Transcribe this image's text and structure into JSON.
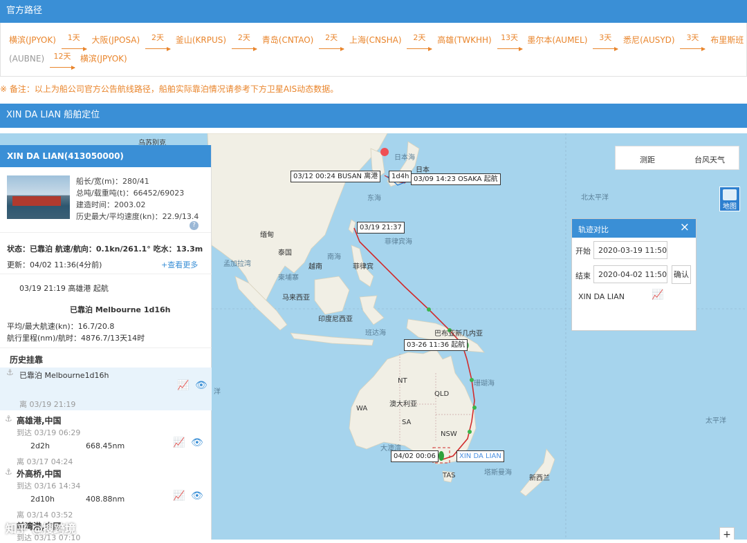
{
  "official_route": {
    "title": "官方路径",
    "stops": [
      {
        "name": "横滨",
        "code": "(JPYOK)"
      },
      {
        "name": "大阪",
        "code": "(JPOSA)"
      },
      {
        "name": "釜山",
        "code": "(KRPUS)"
      },
      {
        "name": "青岛",
        "code": "(CNTAO)"
      },
      {
        "name": "上海",
        "code": "(CNSHA)"
      },
      {
        "name": "高雄",
        "code": "(TWKHH)"
      },
      {
        "name": "墨尔本",
        "code": "(AUMEL)"
      },
      {
        "name": "悉尼",
        "code": "(AUSYD)"
      },
      {
        "name": "布里斯班",
        "code": "(AUBNE)"
      },
      {
        "name": "横滨",
        "code": "(JPYOK)"
      }
    ],
    "legs": [
      "1天",
      "2天",
      "2天",
      "2天",
      "2天",
      "13天",
      "3天",
      "3天",
      "12天"
    ]
  },
  "note": "※ 备注：以上为船公司官方公告航线路径，船舶实际靠泊情况请参考下方卫星AIS动态数据。",
  "section_title": "XIN DA LIAN 船舶定位",
  "ship_panel": {
    "header": "XIN DA LIAN(413050000)",
    "length_width": "船长/宽(m)：280/41",
    "tonnage": "总吨/载重吨(t)：66452/69023",
    "built": "建造时间：2003.02",
    "speed_hist": "历史最大/平均速度(kn)：22.9/13.4",
    "status": "状态：已靠泊 航速/航向：0.1kn/261.1° 吃水：13.3m",
    "updated": "更新：04/02 11:36(4分前)",
    "more": "+查看更多",
    "departure": "03/19 21:19    高雄港 起航",
    "berthed": "已靠泊 Melbourne 1d16h",
    "avg_speed": "平均/最大航速(kn)：16.7/20.8",
    "distance": "航行里程(nm)/航时：4876.7/13天14时",
    "history_title": "历史挂靠",
    "history": [
      {
        "port": "已靠泊 Melbourne1d16h",
        "leave": "离 03/19 21:19"
      },
      {
        "port": "高雄港,中国",
        "arrive": "到达 03/19 06:29",
        "stay": "2d2h",
        "dist": "668.45nm",
        "leave": "离 03/17 04:24"
      },
      {
        "port": "外高桥,中国",
        "arrive": "到达 03/16 14:34",
        "stay": "2d10h",
        "dist": "408.88nm",
        "leave": "离 03/14 03:52"
      },
      {
        "port": "前湾港,中国",
        "arrive": "到达 03/13 07:10"
      }
    ]
  },
  "map": {
    "labels": {
      "busan": "03/12 00:24 BUSAN 离港",
      "osaka": "03/09 14:23 OSAKA 起航",
      "d4h": "1d4h",
      "start": "03/19 21:37",
      "png": "03-26 11:36 起航",
      "mel": "04/02 00:06",
      "ship": "XIN DA LIAN"
    },
    "places": {
      "wulatebie": "乌苏别克",
      "japan_sea": "日本海",
      "japan": "日本",
      "donghai": "东海",
      "north_pacific": "北太平洋",
      "burma": "缅甸",
      "thailand": "泰国",
      "south_sea": "南海",
      "philippine_sea": "菲律宾海",
      "philippines": "菲律宾",
      "vietnam": "越南",
      "bengal": "孟加拉湾",
      "cambodia": "柬埔寨",
      "malaysia": "马来西亚",
      "indonesia": "印度尼西亚",
      "banda": "班达海",
      "png": "巴布亚新几内亚",
      "nt": "NT",
      "qld": "QLD",
      "wa": "WA",
      "sa": "SA",
      "nsw": "NSW",
      "australia": "澳大利亚",
      "great_bay": "大澳湾",
      "tasman": "塔斯曼海",
      "tas": "TAS",
      "nz": "新西兰",
      "pacific": "太平洋",
      "ocean": "洋",
      "coral": "珊瑚海"
    },
    "toolbox": {
      "measure": "测距",
      "typhoon": "台风天气"
    },
    "map_button": "地图",
    "zoom_in": "+"
  },
  "trajectory": {
    "title": "轨迹对比",
    "start_label": "开始",
    "start_value": "2020-03-19 11:50",
    "end_label": "结束",
    "end_value": "2020-04-02 11:50",
    "confirm": "确认",
    "ship_name": "XIN DA LIAN"
  },
  "watermark": "知乎 @搜跨境",
  "colors": {
    "accent": "#3a8fd6",
    "orange": "#e9852c",
    "track": "#d12b2b",
    "sea": "#a6d4ed",
    "land": "#f1efe5"
  }
}
